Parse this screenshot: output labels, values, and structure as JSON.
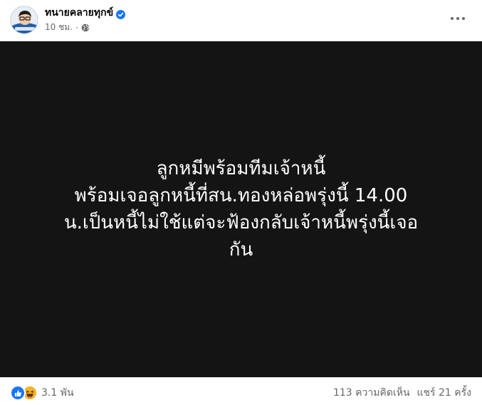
{
  "post": {
    "author": "ทนายคลายทุกข์",
    "time": "10 ชม.",
    "separator": "·"
  },
  "image_text": "ลูกหมีพร้อมทีมเจ้าหนี้\nพร้อมเจอลูกหนี้ที่สน.ทองหล่อพรุ่งนี้ 14.00\nน.เป็นหนี้ไม่ใช้แต่จะฟ้องกลับเจ้าหนี้พรุ่งนี้เจอ\nกัน",
  "footer": {
    "reaction_count": "3.1 พัน",
    "comments": "113 ความคิดเห็น",
    "shares": "แชร์ 21 ครั้ง"
  },
  "icons": {
    "verified": "verified-badge-icon",
    "globe": "globe-icon",
    "more": "more-options-icon",
    "like": "like-reaction-icon",
    "haha": "haha-reaction-icon"
  },
  "colors": {
    "accent": "#1877f2",
    "image_background": "#141414",
    "secondary_text": "#65676b"
  }
}
